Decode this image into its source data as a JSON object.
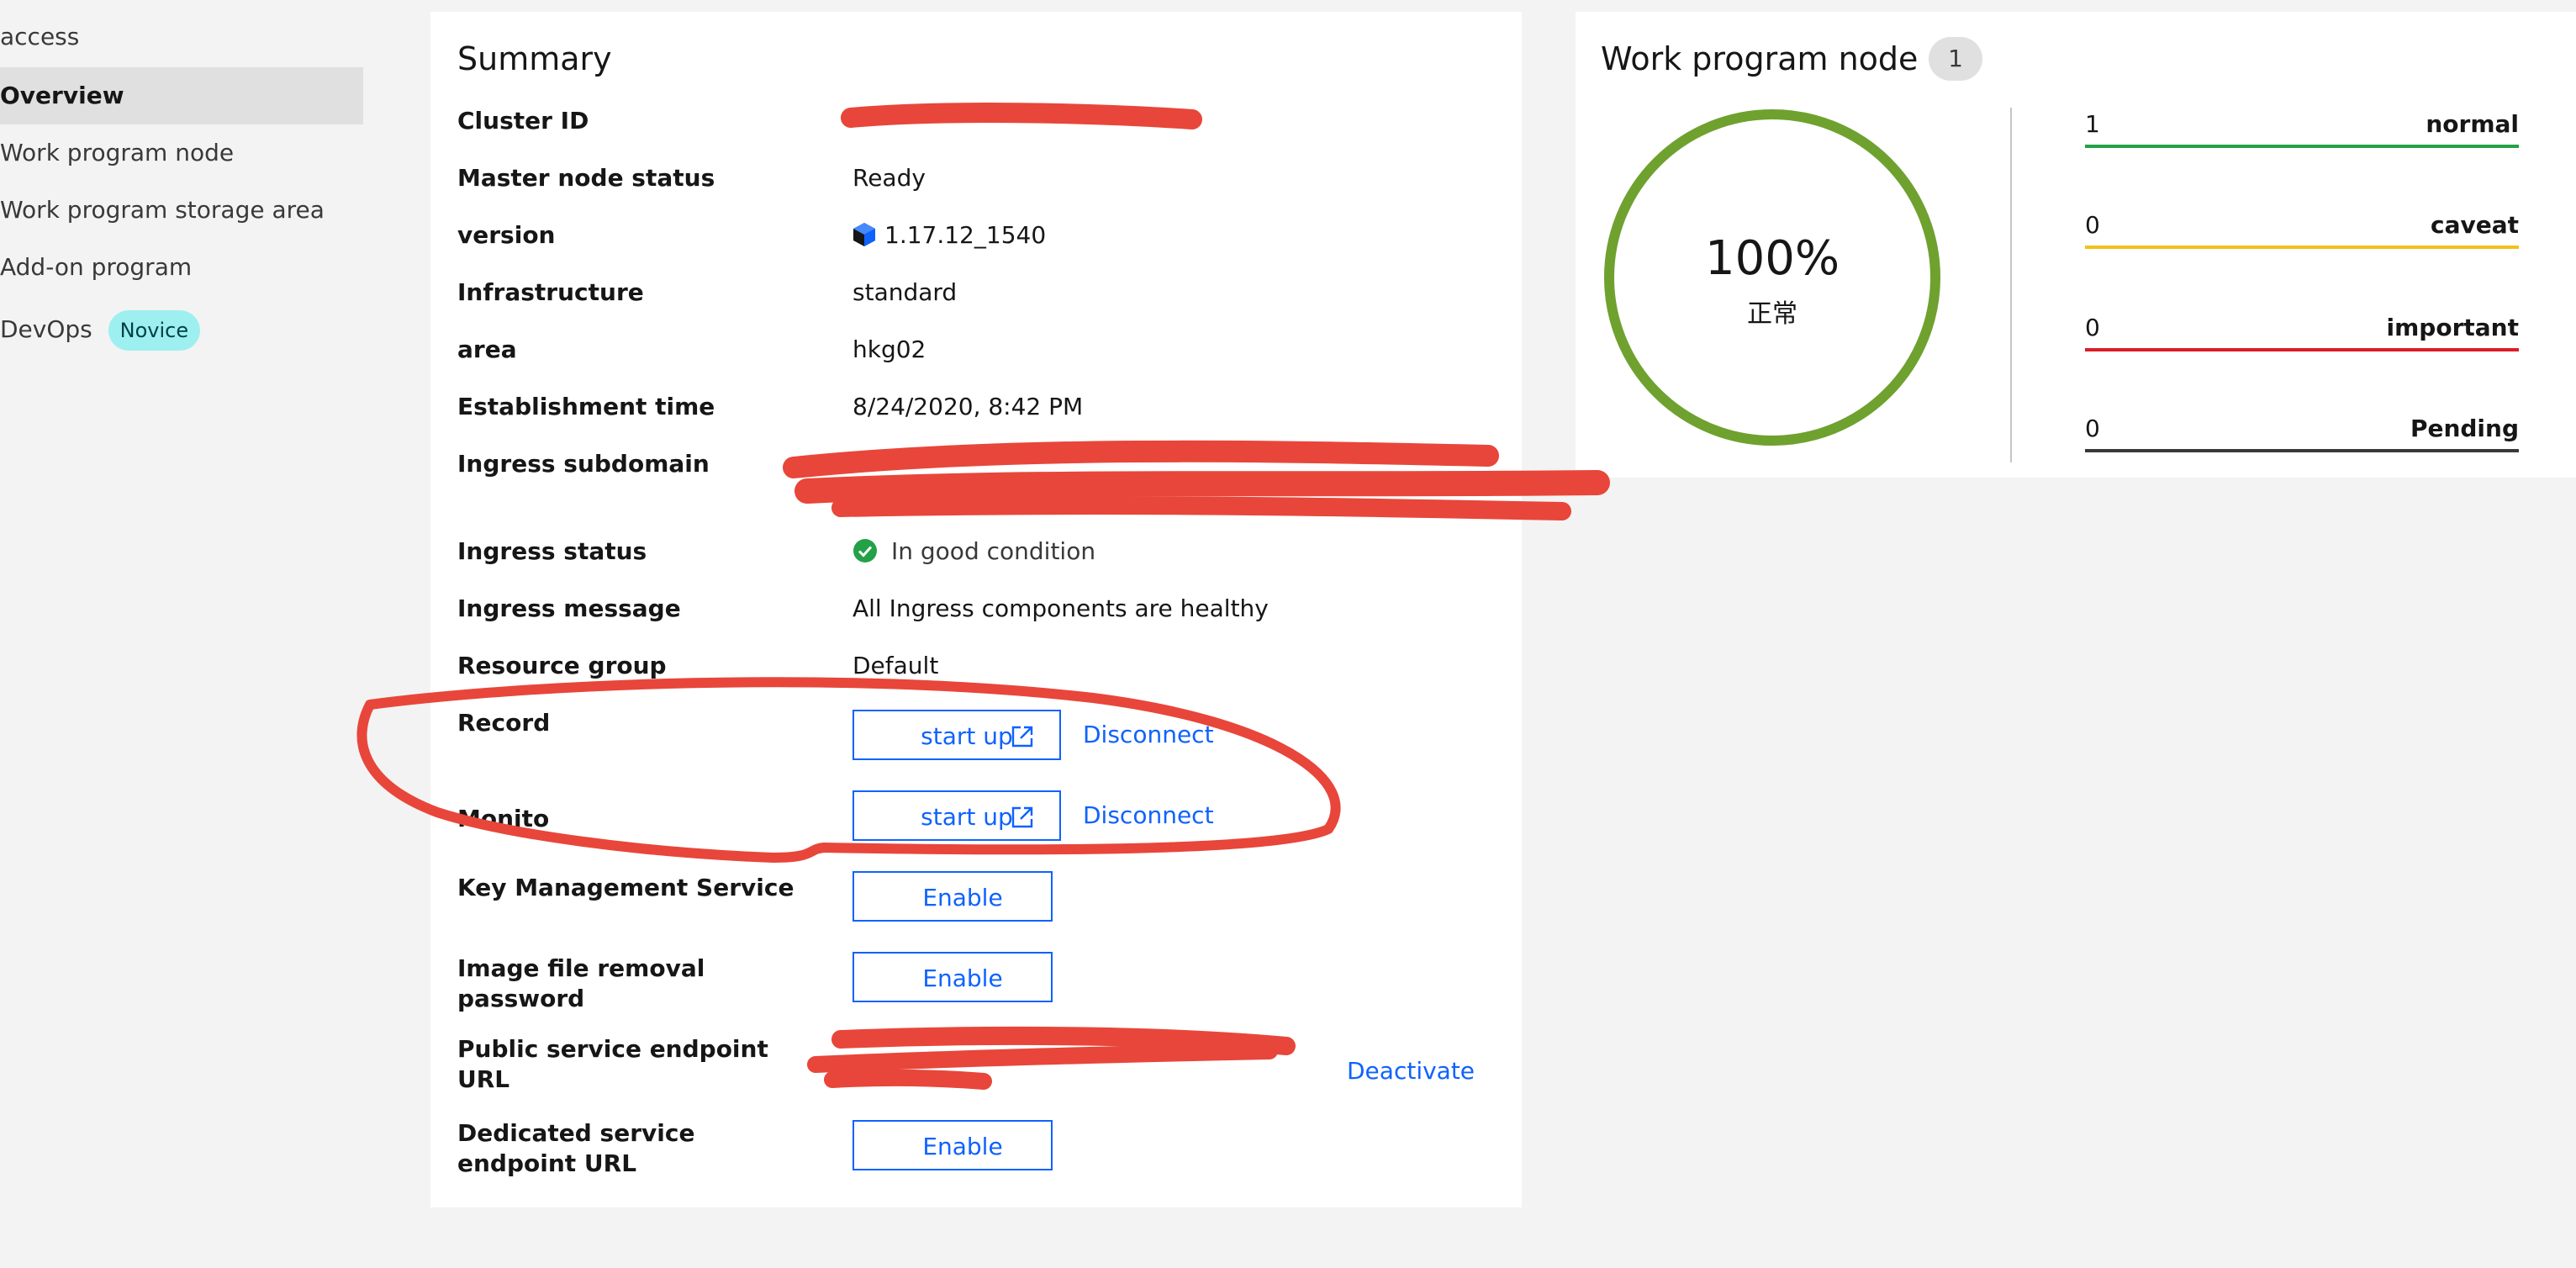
{
  "sidebar": {
    "items": [
      {
        "label": "access"
      },
      {
        "label": "Overview"
      },
      {
        "label": "Work program node"
      },
      {
        "label": "Work program storage area"
      },
      {
        "label": "Add-on program"
      },
      {
        "label": "DevOps",
        "badge": "Novice"
      }
    ],
    "active_item": "Overview"
  },
  "summary": {
    "title": "Summary",
    "rows": {
      "cluster_id": {
        "label": "Cluster ID",
        "value": ""
      },
      "master_status": {
        "label": "Master node status",
        "value": "Ready"
      },
      "version": {
        "label": "version",
        "value": "1.17.12_1540",
        "icon": "kubernetes-hex-icon"
      },
      "infrastructure": {
        "label": "Infrastructure",
        "value": "standard"
      },
      "area": {
        "label": "area",
        "value": "hkg02"
      },
      "established": {
        "label": "Establishment time",
        "value": "8/24/2020, 8:42 PM"
      },
      "ingress_subdomain": {
        "label": "Ingress subdomain",
        "value": ""
      },
      "ingress_status": {
        "label": "Ingress status",
        "value": "In good condition",
        "icon": "checkmark-filled-icon"
      },
      "ingress_message": {
        "label": "Ingress message",
        "value": "All Ingress components are healthy"
      },
      "resource_group": {
        "label": "Resource group",
        "value": "Default"
      },
      "record": {
        "label": "Record",
        "launch": "start up",
        "disconnect": "Disconnect"
      },
      "monitor": {
        "label": "Monito",
        "launch": "start up",
        "disconnect": "Disconnect"
      },
      "kms": {
        "label": "Key Management Service",
        "action": "Enable"
      },
      "image_pull": {
        "label": "Image file removal password",
        "action": "Enable"
      },
      "public_endpoint": {
        "label": "Public service endpoint URL",
        "value": "",
        "action": "Deactivate"
      },
      "private_endpoint": {
        "label": "Dedicated service endpoint URL",
        "action": "Enable"
      }
    }
  },
  "nodes": {
    "title": "Work program node",
    "count": "1",
    "donut": {
      "percent_text": "100%",
      "label": "正常",
      "healthy_fraction": 1.0
    },
    "statuses": [
      {
        "count": "1",
        "name": "normal",
        "color": "#24a148"
      },
      {
        "count": "0",
        "name": "caveat",
        "color": "#f1c21b"
      },
      {
        "count": "0",
        "name": "important",
        "color": "#da1e28"
      },
      {
        "count": "0",
        "name": "Pending",
        "color": "#393939"
      }
    ],
    "donut_color": "#6fa12f"
  },
  "colors": {
    "accent": "#0f62fe",
    "annotation": "#e8463a",
    "page_background": "#f3f3f3"
  }
}
